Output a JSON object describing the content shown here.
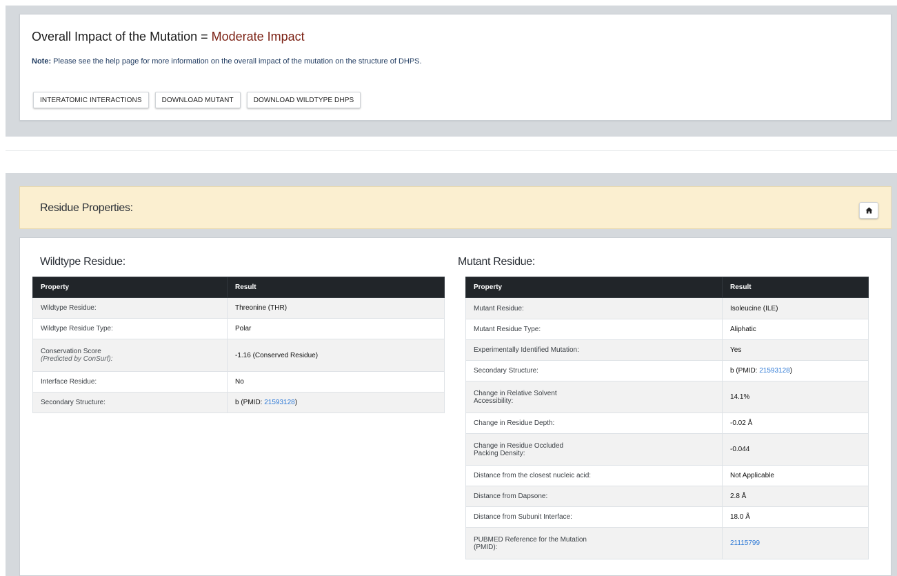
{
  "impact": {
    "title_prefix": "Overall Impact of the Mutation = ",
    "value": "Moderate Impact",
    "note_label": "Note:",
    "note_text": " Please see the help page for more information on the overall impact of the mutation on the structure of DHPS.",
    "buttons": {
      "interatomic": "INTERATOMIC INTERACTIONS",
      "download_mutant": "DOWNLOAD MUTANT",
      "download_wildtype": "DOWNLOAD WILDTYPE DHPS"
    }
  },
  "residue_panel": {
    "title": "Residue Properties:",
    "home_icon": "home-icon"
  },
  "wildtype": {
    "title": "Wildtype Residue:",
    "headers": [
      "Property",
      "Result"
    ],
    "rows": [
      {
        "property": "Wildtype Residue:",
        "result": "Threonine (THR)"
      },
      {
        "property": "Wildtype Residue Type:",
        "result": "Polar"
      },
      {
        "property": "Conservation Score",
        "property_sub": "(Predicted by ConSurf):",
        "result": "-1.16 (Conserved Residue)"
      },
      {
        "property": "Interface Residue:",
        "result": "No"
      },
      {
        "property": "Secondary Structure:",
        "result_prefix": "b (PMID: ",
        "result_link": "21593128",
        "result_suffix": ")"
      }
    ]
  },
  "mutant": {
    "title": "Mutant Residue:",
    "headers": [
      "Property",
      "Result"
    ],
    "rows": [
      {
        "property": "Mutant Residue:",
        "result": "Isoleucine (ILE)"
      },
      {
        "property": "Mutant Residue Type:",
        "result": "Aliphatic"
      },
      {
        "property": "Experimentally Identified Mutation:",
        "result": "Yes"
      },
      {
        "property": "Secondary Structure:",
        "result_prefix": "b (PMID: ",
        "result_link": "21593128",
        "result_suffix": ")"
      },
      {
        "property": "Change in Relative Solvent",
        "property_line2": "Accessibility:",
        "result": "14.1%"
      },
      {
        "property": "Change in Residue Depth:",
        "result": "-0.02 Å"
      },
      {
        "property": "Change in Residue Occluded",
        "property_line2": "Packing Density:",
        "result": "-0.044"
      },
      {
        "property": "Distance from the closest nucleic acid:",
        "result": "Not Applicable"
      },
      {
        "property": "Distance from Dapsone:",
        "result": "2.8 Å"
      },
      {
        "property": "Distance from Subunit Interface:",
        "result": "18.0 Å"
      },
      {
        "property": "PUBMED Reference for the Mutation",
        "property_line2": "(PMID):",
        "result_link": "21115799"
      }
    ]
  }
}
